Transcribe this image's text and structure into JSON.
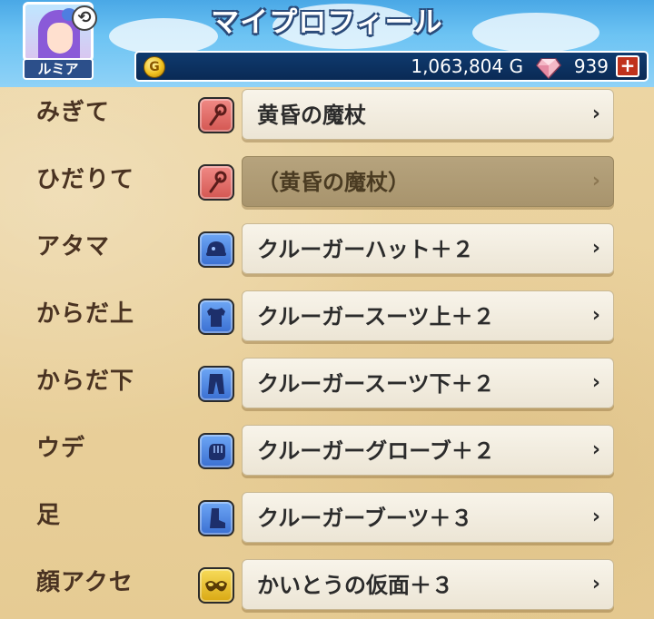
{
  "header": {
    "title": "マイプロフィール",
    "character_name": "ルミア",
    "swap_icon": "swap-icon",
    "gold": "1,063,804 G",
    "gems": "939",
    "plus_label": "+"
  },
  "colors": {
    "header_sky": "#4aa8e6",
    "currency_bar": "#0f3a6e",
    "parchment": "#e9d2a0",
    "label_text": "#4a3322",
    "icon_red": "#d45752",
    "icon_blue": "#3a6fd2",
    "icon_gold": "#d9a813",
    "plus_button": "#c0321c"
  },
  "equipment": [
    {
      "slot": "みぎて",
      "item": "黄昏の魔杖",
      "icon": "staff-icon",
      "icon_color": "red",
      "enabled": true
    },
    {
      "slot": "ひだりて",
      "item": "（黄昏の魔杖）",
      "icon": "staff-icon",
      "icon_color": "red",
      "enabled": false
    },
    {
      "slot": "アタマ",
      "item": "クルーガーハット＋２",
      "icon": "helmet-icon",
      "icon_color": "blue",
      "enabled": true
    },
    {
      "slot": "からだ上",
      "item": "クルーガースーツ上＋２",
      "icon": "shirt-icon",
      "icon_color": "blue",
      "enabled": true
    },
    {
      "slot": "からだ下",
      "item": "クルーガースーツ下＋２",
      "icon": "pants-icon",
      "icon_color": "blue",
      "enabled": true
    },
    {
      "slot": "ウデ",
      "item": "クルーガーグローブ＋２",
      "icon": "glove-icon",
      "icon_color": "blue",
      "enabled": true
    },
    {
      "slot": "足",
      "item": "クルーガーブーツ＋３",
      "icon": "boot-icon",
      "icon_color": "blue",
      "enabled": true
    },
    {
      "slot": "顔アクセ",
      "item": "かいとうの仮面＋３",
      "icon": "mask-icon",
      "icon_color": "gold",
      "enabled": true
    }
  ],
  "chevron": "›"
}
